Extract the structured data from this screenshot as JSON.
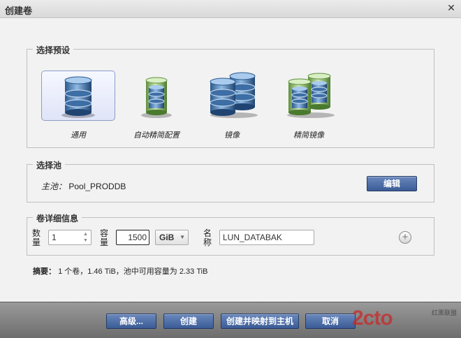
{
  "window": {
    "title": "创建卷"
  },
  "presets": {
    "legend": "选择预设",
    "items": [
      {
        "label": "通用",
        "icon": "database-icon",
        "selected": true
      },
      {
        "label": "自动精简配置",
        "icon": "thin-provision-database-icon",
        "selected": false
      },
      {
        "label": "镜像",
        "icon": "mirror-database-icon",
        "selected": false
      },
      {
        "label": "精简镜像",
        "icon": "thin-mirror-database-icon",
        "selected": false
      }
    ]
  },
  "pool": {
    "legend": "选择池",
    "label": "主池：",
    "value": "Pool_PRODDB",
    "edit_label": "编辑"
  },
  "details": {
    "legend": "卷详细信息",
    "count_label": "数量",
    "count_value": "1",
    "capacity_label": "容量",
    "capacity_value": "1500",
    "unit_value": "GiB",
    "name_label": "名称",
    "name_value": "LUN_DATABAK"
  },
  "summary": {
    "label": "摘要：",
    "text": "1 个卷，1.46 TiB，池中可用容量为 2.33 TiB"
  },
  "buttons": {
    "advanced": "高级...",
    "create": "创建",
    "create_map": "创建并映射到主机",
    "cancel": "取消"
  },
  "watermark": {
    "main": "2cto",
    "sub": "红黑联盟"
  },
  "colors": {
    "accent": "#3f5f98",
    "title_bg": "#dedede",
    "footer_bg": "#7e7e7e",
    "db_blue": "#5a8ec0",
    "db_green": "#8fbf6a"
  }
}
